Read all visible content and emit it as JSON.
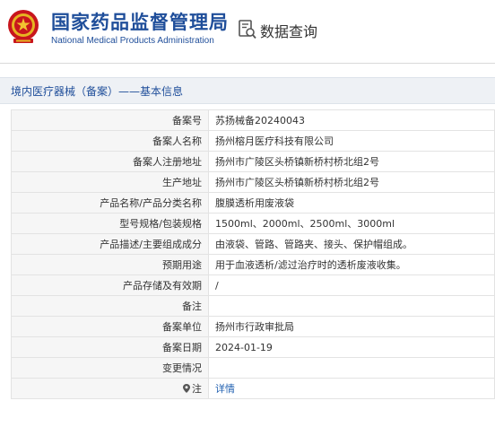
{
  "header": {
    "title_cn": "国家药品监督管理局",
    "title_en": "National Medical Products Administration",
    "query_label": "数据查询",
    "emblem_icon": "national-emblem-icon",
    "query_icon": "document-search-icon",
    "brand_color": "#1f4e9a",
    "emblem_color": "#c8161d"
  },
  "section": {
    "breadcrumb": "境内医疗器械（备案）——基本信息"
  },
  "record": {
    "rows": [
      {
        "label": "备案号",
        "value": "苏扬械备20240043"
      },
      {
        "label": "备案人名称",
        "value": "扬州榕月医疗科技有限公司"
      },
      {
        "label": "备案人注册地址",
        "value": "扬州市广陵区头桥镇新桥村桥北组2号"
      },
      {
        "label": "生产地址",
        "value": "扬州市广陵区头桥镇新桥村桥北组2号"
      },
      {
        "label": "产品名称/产品分类名称",
        "value": "腹膜透析用废液袋"
      },
      {
        "label": "型号规格/包装规格",
        "value": "1500ml、2000ml、2500ml、3000ml"
      },
      {
        "label": "产品描述/主要组成成分",
        "value": "由液袋、管路、管路夹、接头、保护帽组成。"
      },
      {
        "label": "预期用途",
        "value": "用于血液透析/滤过治疗时的透析废液收集。"
      },
      {
        "label": "产品存储及有效期",
        "value": "/"
      },
      {
        "label": "备注",
        "value": ""
      },
      {
        "label": "备案单位",
        "value": "扬州市行政审批局"
      },
      {
        "label": "备案日期",
        "value": "2024-01-19"
      },
      {
        "label": "变更情况",
        "value": ""
      }
    ],
    "note_label": "注",
    "note_icon": "location-pin-icon",
    "note_link": "详情",
    "link_color": "#1f5fb0"
  }
}
